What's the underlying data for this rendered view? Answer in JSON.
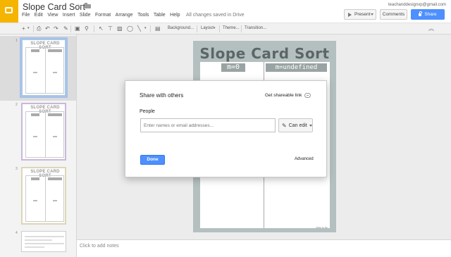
{
  "app": {
    "title": "Slope Card Sort",
    "menu": [
      "File",
      "Edit",
      "View",
      "Insert",
      "Slide",
      "Format",
      "Arrange",
      "Tools",
      "Table",
      "Help"
    ],
    "save_status": "All changes saved in Drive",
    "user_email": "teachanddesignxp@gmail.com",
    "present_label": "Present",
    "comments_label": "Comments",
    "share_label": "Share"
  },
  "toolbar": {
    "background_label": "Background...",
    "layout_label": "Layout",
    "theme_label": "Theme...",
    "transition_label": "Transition..."
  },
  "filmstrip": {
    "slides": [
      {
        "number": "1",
        "title": "SLOPE CARD SORT"
      },
      {
        "number": "2",
        "title": "SLOPE CARD SORT"
      },
      {
        "number": "3",
        "title": "SLOPE CARD SORT"
      },
      {
        "number": "4",
        "title": ""
      }
    ]
  },
  "slide": {
    "title": "Slope Card Sort",
    "header_left": "m=0",
    "header_right": "m=undefined",
    "credit": "Made by Me"
  },
  "notes": {
    "placeholder": "Click to add notes"
  },
  "share_dialog": {
    "title": "Share with others",
    "link_label": "Get shareable link",
    "people_label": "People",
    "input_placeholder": "Enter names or email addresses...",
    "permission_label": "Can edit",
    "done_label": "Done",
    "advanced_label": "Advanced"
  },
  "colors": {
    "accent": "#4d90fe",
    "logo": "#f4b400",
    "slide_border": "#b4c0c0"
  }
}
